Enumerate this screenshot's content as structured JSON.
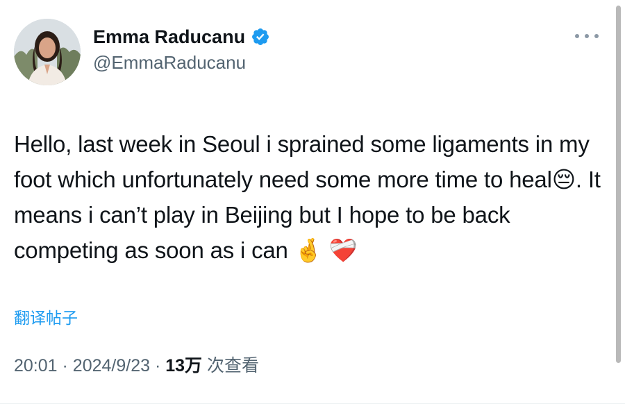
{
  "tweet": {
    "author": {
      "display_name": "Emma Raducanu",
      "handle": "@EmmaRaducanu",
      "verified": true,
      "verified_color": "#1d9bf0"
    },
    "text": "Hello, last week in Seoul i sprained some ligaments in my foot which unfortunately need some more time to heal😔. It means i can’t play in Beijing but I hope to be back competing as soon as i can 🤞 ❤️‍🩹",
    "translate_label": "翻译帖子",
    "time": "20:01",
    "date": "2024/9/23",
    "view_count": "13万",
    "views_label": "次查看",
    "separator": "·"
  }
}
